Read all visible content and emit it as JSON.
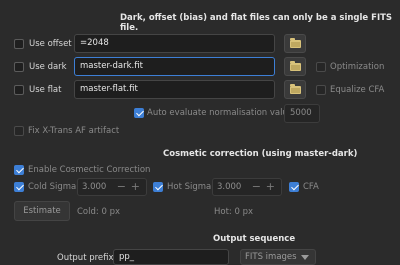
{
  "header": {
    "notice": "Dark, offset (bias) and flat files can only be a single FITS file."
  },
  "offset": {
    "label": "Use offset",
    "value": "=2048",
    "checked": false
  },
  "dark": {
    "label": "Use dark",
    "value": "master-dark.fit",
    "checked": false,
    "optimization_label": "Optimization"
  },
  "flat": {
    "label": "Use flat",
    "value": "master-flat.fit",
    "checked": false,
    "equalize_label": "Equalize CFA"
  },
  "normalisation": {
    "label": "Auto evaluate normalisation value",
    "checked": true,
    "value": "5000"
  },
  "xtrans": {
    "label": "Fix X-Trans AF artifact",
    "checked": false
  },
  "cosmetic": {
    "title": "Cosmetic correction (using master-dark)",
    "enable_label": "Enable Cosmectic Correction",
    "enable_checked": true,
    "cold_label": "Cold Sigma:",
    "cold_value": "3.000",
    "cold_checked": true,
    "hot_label": "Hot Sigma:",
    "hot_value": "3.000",
    "hot_checked": true,
    "cfa_label": "CFA",
    "cfa_checked": true,
    "minus": "−",
    "plus": "+",
    "estimate_label": "Estimate",
    "cold_count": "Cold: 0 px",
    "hot_count": "Hot: 0 px"
  },
  "output": {
    "title": "Output sequence",
    "prefix_label": "Output prefix:",
    "prefix_value": "pp_",
    "format_value": "FITS images"
  },
  "colors": {
    "accent": "#3d7fd6",
    "background": "#2b2b2b"
  }
}
